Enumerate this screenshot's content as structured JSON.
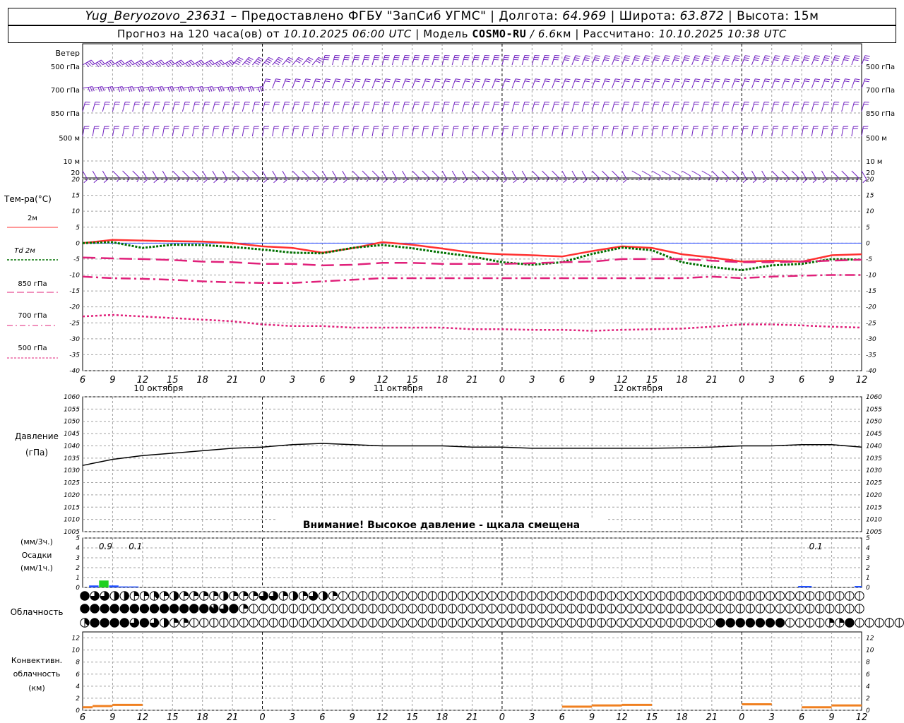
{
  "header": {
    "station": "Yug_Beryozovo_23631",
    "provider": " – Предоставлено ФГБУ \"ЗапСиб УГМС\" | Долгота: ",
    "lon": "64.969",
    "lat_label": " | Широта: ",
    "lat": "63.872",
    "alt_label": " | Высота: ",
    "alt": "15м",
    "forecast_label": "Прогноз на 120 часа(ов) от ",
    "forecast_time": "10.10.2025 06:00 UTC",
    "model_label": "  | Модель ",
    "model": "COSMO-RU",
    "res": " / 6.6",
    "res_unit": "км",
    "calc_label": " | Рассчитано: ",
    "calc_time": "10.10.2025 10:38 UTC"
  },
  "colors": {
    "temp2m": "#ff3030",
    "td": "#007000",
    "t850": "#e0207a",
    "t700": "#e0207a",
    "t500": "#e0207a",
    "wind": "#7020c0",
    "pressure": "#000000",
    "zero": "#3050ff",
    "grid": "#a0a0a0"
  },
  "chart_data": [
    {
      "type": "wind-barbs",
      "title": "Ветер",
      "levels": [
        "500 гПа",
        "700 гПа",
        "850 гПа",
        "500 м",
        "10  м"
      ],
      "x_ticks": [
        "6",
        "9",
        "12",
        "15",
        "18",
        "21",
        "0",
        "3",
        "6",
        "9",
        "12",
        "15",
        "18",
        "21",
        "0",
        "3",
        "6",
        "9",
        "12",
        "15",
        "18",
        "21",
        "0",
        "3",
        "6",
        "9",
        "12"
      ]
    },
    {
      "type": "line",
      "title": "Тем-ра(°С)",
      "ylim": [
        -40,
        20
      ],
      "y_ticks": [
        20,
        15,
        10,
        5,
        0,
        -5,
        -10,
        -15,
        -20,
        -25,
        -30,
        -35,
        -40
      ],
      "x_hours": [
        0,
        3,
        6,
        9,
        12,
        15,
        18,
        21,
        24,
        27,
        30,
        33,
        36,
        39,
        42,
        45,
        48,
        51,
        54,
        57,
        60,
        63,
        66,
        69,
        72,
        75,
        78
      ],
      "x_ticks": [
        "6",
        "9",
        "12",
        "15",
        "18",
        "21",
        "0",
        "3",
        "6",
        "9",
        "12",
        "15",
        "18",
        "21",
        "0",
        "3",
        "6",
        "9",
        "12",
        "15",
        "18",
        "21",
        "0",
        "3",
        "6",
        "9",
        "12"
      ],
      "day_labels": [
        "10 октября",
        "11 октября",
        "12 октября"
      ],
      "series": [
        {
          "name": "2м",
          "values": [
            0,
            1,
            0.8,
            0.6,
            0.5,
            0,
            -1,
            -1.5,
            -3,
            -1.6,
            0.3,
            -0.5,
            -1.7,
            -3,
            -3.5,
            -3.8,
            -4.2,
            -2.5,
            -1,
            -1.5,
            -3.5,
            -4.5,
            -5.8,
            -5.5,
            -5.8,
            -3.8,
            -3.5
          ]
        },
        {
          "name": "Td  2м",
          "values": [
            0,
            0.3,
            -1.5,
            -0.5,
            -0.6,
            -1.2,
            -2,
            -3,
            -3.2,
            -1.5,
            -0.6,
            -1.6,
            -3,
            -4.2,
            -6,
            -6.8,
            -6,
            -3.4,
            -1.4,
            -2.2,
            -6,
            -7.5,
            -8.5,
            -7,
            -6.5,
            -5,
            -5.2
          ]
        },
        {
          "name": "850 гПа",
          "values": [
            -4.5,
            -4.8,
            -5,
            -5.3,
            -5.8,
            -6,
            -6.5,
            -6.5,
            -7,
            -6.8,
            -6.2,
            -6.2,
            -6.5,
            -6.5,
            -6.5,
            -6.3,
            -6,
            -5.8,
            -5,
            -5,
            -5,
            -5.5,
            -6,
            -6,
            -5.8,
            -5.5,
            -5.2
          ]
        },
        {
          "name": "700 гПа",
          "values": [
            -10.5,
            -11,
            -11.2,
            -11.5,
            -12,
            -12.3,
            -12.5,
            -12.5,
            -12,
            -11.5,
            -11,
            -11,
            -11,
            -11,
            -11,
            -11,
            -11,
            -11,
            -11,
            -11,
            -11,
            -10.5,
            -11,
            -10.5,
            -10.2,
            -10,
            -10
          ]
        },
        {
          "name": "500 гПа",
          "values": [
            -23,
            -22.5,
            -23,
            -23.5,
            -24,
            -24.5,
            -25.5,
            -26,
            -26,
            -26.5,
            -26.5,
            -26.5,
            -26.5,
            -27,
            -27,
            -27.2,
            -27.2,
            -27.5,
            -27.2,
            -27,
            -26.8,
            -26.2,
            -25.5,
            -25.5,
            -25.8,
            -26.2,
            -26.5
          ]
        }
      ]
    },
    {
      "type": "line",
      "title": "Давление",
      "ylabel": "(гПа)",
      "ylim": [
        1005,
        1060
      ],
      "y_ticks": [
        1060,
        1055,
        1050,
        1045,
        1040,
        1035,
        1030,
        1025,
        1020,
        1015,
        1010,
        1005
      ],
      "x_hours": [
        0,
        3,
        6,
        9,
        12,
        15,
        18,
        21,
        24,
        27,
        30,
        33,
        36,
        39,
        42,
        45,
        48,
        51,
        54,
        57,
        60,
        63,
        66,
        69,
        72,
        75,
        78
      ],
      "series": [
        {
          "name": "pressure",
          "values": [
            1032,
            1034.5,
            1036,
            1037,
            1038,
            1039,
            1039.5,
            1040.5,
            1041,
            1040.5,
            1040,
            1040,
            1040,
            1039.5,
            1039.5,
            1039,
            1039,
            1039,
            1039,
            1039,
            1039.2,
            1039.5,
            1040,
            1040,
            1040.5,
            1040.5,
            1039.5
          ]
        }
      ],
      "annotation": "Внимание! Высокое давление - щкала смещена"
    },
    {
      "type": "bar",
      "title": "Осадки",
      "ylabel_top": "(мм/3ч.)",
      "ylabel_bottom": "(мм/1ч.)",
      "ylim": [
        0,
        5
      ],
      "y_ticks": [
        5,
        4,
        3,
        2,
        1,
        0
      ],
      "totals": [
        {
          "hour": 3,
          "value": "0.9"
        },
        {
          "hour": 6,
          "value": "0.1"
        },
        {
          "hour": 72,
          "value": "0.1"
        }
      ],
      "bars_1h": [
        {
          "hour": 1,
          "value": 0.2
        },
        {
          "hour": 2,
          "value": 0.7
        },
        {
          "hour": 3,
          "value": 0.2
        },
        {
          "hour": 4,
          "value": 0.1
        },
        {
          "hour": 5,
          "value": 0.1
        }
      ]
    },
    {
      "type": "cloud-symbols",
      "title": "Облачность",
      "rows": [
        [
          8,
          6,
          6,
          4,
          4,
          2,
          2,
          3,
          2,
          4,
          2,
          2,
          2,
          2,
          4,
          2,
          2,
          2,
          6,
          6,
          2,
          4,
          2,
          6,
          4,
          2,
          0,
          0,
          0,
          0,
          0,
          0,
          0,
          0,
          0,
          0,
          0,
          0,
          0,
          0,
          0,
          0,
          0,
          0,
          0,
          0,
          0,
          0,
          0,
          0,
          0,
          0,
          0,
          0,
          0,
          0,
          0,
          0,
          0,
          0,
          0,
          0,
          0,
          0,
          0,
          0,
          0,
          0,
          0,
          0,
          0,
          0,
          0,
          0,
          0,
          0,
          0,
          0,
          0
        ],
        [
          8,
          8,
          8,
          8,
          8,
          8,
          8,
          8,
          8,
          8,
          8,
          8,
          8,
          7,
          6,
          8,
          2,
          0,
          0,
          0,
          0,
          0,
          0,
          0,
          0,
          0,
          0,
          0,
          0,
          0,
          0,
          0,
          0,
          0,
          0,
          0,
          0,
          0,
          0,
          0,
          0,
          0,
          0,
          0,
          0,
          0,
          0,
          0,
          0,
          0,
          0,
          0,
          0,
          0,
          0,
          0,
          0,
          0,
          0,
          0,
          0,
          0,
          0,
          0,
          0,
          0,
          0,
          0,
          0,
          0,
          0,
          0,
          0,
          0,
          0,
          0,
          0,
          0,
          0
        ],
        [
          3,
          8,
          8,
          8,
          8,
          6,
          8,
          6,
          4,
          2,
          2,
          0,
          0,
          0,
          0,
          0,
          0,
          0,
          0,
          0,
          0,
          0,
          0,
          0,
          0,
          0,
          0,
          0,
          0,
          0,
          0,
          0,
          0,
          0,
          0,
          0,
          0,
          0,
          0,
          0,
          0,
          0,
          0,
          0,
          0,
          0,
          0,
          0,
          0,
          0,
          0,
          0,
          0,
          0,
          0,
          0,
          0,
          0,
          0,
          0,
          0,
          0,
          0,
          0,
          8,
          8,
          8,
          8,
          8,
          8,
          8,
          0,
          0,
          0,
          0,
          2,
          2,
          8,
          0,
          0,
          0,
          0,
          0,
          8,
          2
        ]
      ]
    },
    {
      "type": "bar",
      "title": "Конвективн.",
      "ylabel": "облачность",
      "unit": "(км)",
      "ylim": [
        0,
        13
      ],
      "y_ticks": [
        12,
        10,
        8,
        6,
        4,
        2,
        0
      ],
      "segments": [
        [
          0,
          1,
          0.5
        ],
        [
          1,
          3,
          0.7
        ],
        [
          3,
          6,
          0.9
        ],
        [
          48,
          51,
          0.6
        ],
        [
          51,
          54,
          0.8
        ],
        [
          54,
          57,
          0.9
        ],
        [
          66,
          69,
          1
        ],
        [
          72,
          75,
          0.5
        ],
        [
          75,
          78,
          0.8
        ]
      ]
    }
  ]
}
